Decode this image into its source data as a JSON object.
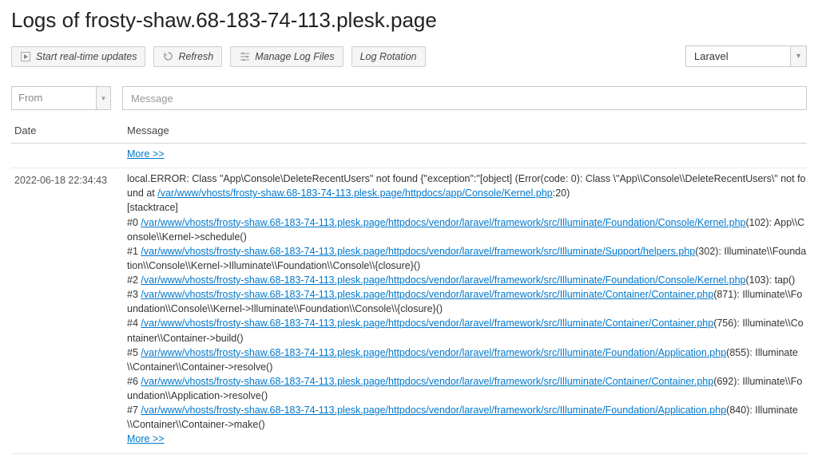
{
  "header": {
    "title": "Logs of frosty-shaw.68-183-74-113.plesk.page"
  },
  "toolbar": {
    "start_realtime_label": "Start real-time updates",
    "refresh_label": "Refresh",
    "manage_log_files_label": "Manage Log Files",
    "log_rotation_label": "Log Rotation",
    "source_select": {
      "value": "Laravel"
    }
  },
  "filters": {
    "from_placeholder": "From",
    "message_placeholder": "Message"
  },
  "table": {
    "headers": {
      "date": "Date",
      "message": "Message"
    },
    "more_label": "More >>",
    "top_row": {
      "date": ""
    },
    "rows": [
      {
        "date": "2022-06-18 22:34:43",
        "prefix": "local.ERROR: Class \"App\\Console\\DeleteRecentUsers\" not found {\"exception\":\"[object] (Error(code: 0): Class \\\"App\\\\Console\\\\DeleteRecentUsers\\\" not found at ",
        "first_path": "/var/www/vhosts/frosty-shaw.68-183-74-113.plesk.page/httpdocs/app/Console/Kernel.php",
        "first_suffix": ":20)",
        "stacktrace_label": "[stacktrace]",
        "stack": [
          {
            "pre": "#0 ",
            "path": "/var/www/vhosts/frosty-shaw.68-183-74-113.plesk.page/httpdocs/vendor/laravel/framework/src/Illuminate/Foundation/Console/Kernel.php",
            "suf": "(102): App\\\\Console\\\\Kernel->schedule()"
          },
          {
            "pre": "#1 ",
            "path": "/var/www/vhosts/frosty-shaw.68-183-74-113.plesk.page/httpdocs/vendor/laravel/framework/src/Illuminate/Support/helpers.php",
            "suf": "(302): Illuminate\\\\Foundation\\\\Console\\\\Kernel->Illuminate\\\\Foundation\\\\Console\\\\{closure}()"
          },
          {
            "pre": "#2 ",
            "path": "/var/www/vhosts/frosty-shaw.68-183-74-113.plesk.page/httpdocs/vendor/laravel/framework/src/Illuminate/Foundation/Console/Kernel.php",
            "suf": "(103): tap()"
          },
          {
            "pre": "#3 ",
            "path": "/var/www/vhosts/frosty-shaw.68-183-74-113.plesk.page/httpdocs/vendor/laravel/framework/src/Illuminate/Container/Container.php",
            "suf": "(871): Illuminate\\\\Foundation\\\\Console\\\\Kernel->Illuminate\\\\Foundation\\\\Console\\\\{closure}()"
          },
          {
            "pre": "#4 ",
            "path": "/var/www/vhosts/frosty-shaw.68-183-74-113.plesk.page/httpdocs/vendor/laravel/framework/src/Illuminate/Container/Container.php",
            "suf": "(756): Illuminate\\\\Container\\\\Container->build()"
          },
          {
            "pre": "#5 ",
            "path": "/var/www/vhosts/frosty-shaw.68-183-74-113.plesk.page/httpdocs/vendor/laravel/framework/src/Illuminate/Foundation/Application.php",
            "suf": "(855): Illuminate\\\\Container\\\\Container->resolve()"
          },
          {
            "pre": "#6 ",
            "path": "/var/www/vhosts/frosty-shaw.68-183-74-113.plesk.page/httpdocs/vendor/laravel/framework/src/Illuminate/Container/Container.php",
            "suf": "(692): Illuminate\\\\Foundation\\\\Application->resolve()"
          },
          {
            "pre": "#7 ",
            "path": "/var/www/vhosts/frosty-shaw.68-183-74-113.plesk.page/httpdocs/vendor/laravel/framework/src/Illuminate/Foundation/Application.php",
            "suf": "(840): Illuminate\\\\Container\\\\Container->make()"
          }
        ]
      }
    ]
  }
}
